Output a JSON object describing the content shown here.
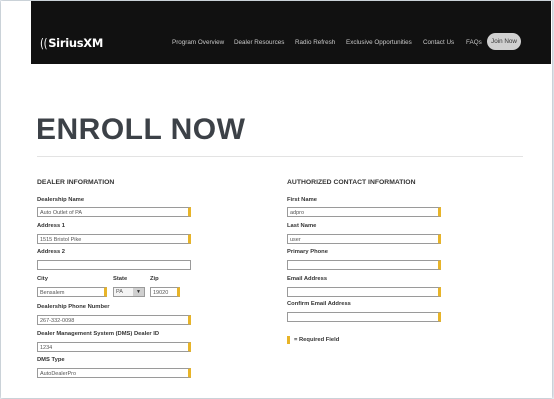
{
  "header": {
    "logo_text": "SiriusXM",
    "logo_mark": "((",
    "nav": [
      "Program Overview",
      "Dealer Resources",
      "Radio Refresh",
      "Exclusive Opportunities",
      "Contact Us",
      "FAQs"
    ],
    "cta": "Join Now"
  },
  "page": {
    "title": "ENROLL NOW"
  },
  "dealer": {
    "heading": "DEALER INFORMATION",
    "dealership_name": {
      "label": "Dealership Name",
      "value": "Auto Outlet of PA"
    },
    "address1": {
      "label": "Address 1",
      "value": "1515 Bristol Pike"
    },
    "address2": {
      "label": "Address 2",
      "value": ""
    },
    "city": {
      "label": "City",
      "value": "Bensalem"
    },
    "state": {
      "label": "State",
      "value": "PA",
      "arrow": "▼"
    },
    "zip": {
      "label": "Zip",
      "value": "19020"
    },
    "phone": {
      "label": "Dealership Phone Number",
      "value": "267-332-0098"
    },
    "dms_id": {
      "label": "Dealer Management System (DMS) Dealer ID",
      "value": "1234"
    },
    "dms_type": {
      "label": "DMS Type",
      "value": "AutoDealerPro"
    }
  },
  "contact": {
    "heading": "AUTHORIZED CONTACT INFORMATION",
    "first_name": {
      "label": "First Name",
      "value": "adpro"
    },
    "last_name": {
      "label": "Last Name",
      "value": "user"
    },
    "primary_phone": {
      "label": "Primary Phone",
      "value": ""
    },
    "email": {
      "label": "Email Address",
      "value": ""
    },
    "confirm_email": {
      "label": "Confirm Email Address",
      "value": ""
    }
  },
  "legend": {
    "required_text": "= Required Field"
  },
  "colors": {
    "header_bg": "#111111",
    "required_accent": "#e8b428",
    "title": "#3c4147"
  }
}
